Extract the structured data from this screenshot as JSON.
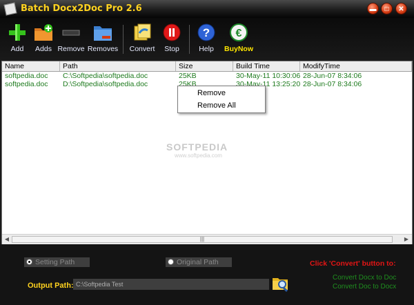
{
  "window": {
    "title": "Batch Docx2Doc Pro 2.6"
  },
  "toolbar": {
    "add": "Add",
    "adds": "Adds",
    "remove": "Remove",
    "removes": "Removes",
    "convert": "Convert",
    "stop": "Stop",
    "help": "Help",
    "buynow": "BuyNow"
  },
  "table": {
    "columns": [
      "Name",
      "Path",
      "Size",
      "Build Time",
      "ModifyTime"
    ],
    "rows": [
      [
        "softpedia.doc",
        "C:\\Softpedia\\softpedia.doc",
        "25KB",
        "30-May-11 10:30:06",
        "28-Jun-07 8:34:06"
      ],
      [
        "softpedia.doc",
        "D:\\Softpedia\\softpedia.doc",
        "25KB",
        "30-May-11 13:25:20",
        "28-Jun-07 8:34:06"
      ]
    ]
  },
  "watermark": "SOFTPEDIA",
  "watermark_sub": "www.softpedia.com",
  "context_menu": {
    "remove": "Remove",
    "remove_all": "Remove All"
  },
  "options": {
    "setting_path": "Setting Path",
    "original_path": "Original Path",
    "selected": "setting_path",
    "output_label": "Output Path:",
    "output_value": "C:\\Softpedia Test"
  },
  "hint": "Click 'Convert' button to:",
  "convert_modes": [
    "Convert Docx to Doc",
    "Convert Doc to Docx"
  ],
  "colors": {
    "title": "#ffd21f",
    "rows": "#1d7a1d",
    "hint": "#e31414",
    "buynow": "#ffe600"
  }
}
